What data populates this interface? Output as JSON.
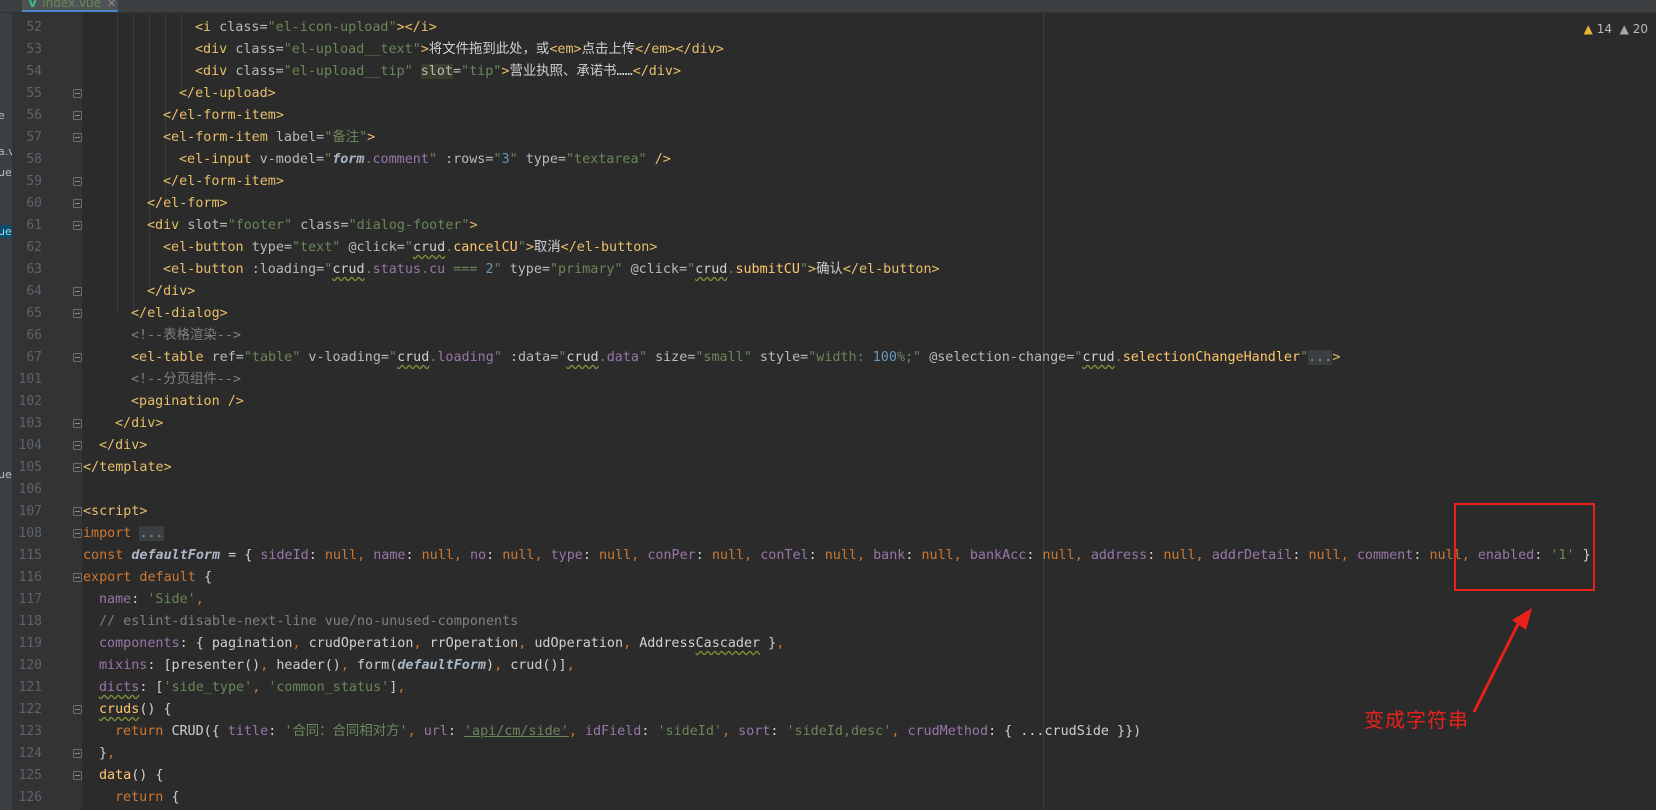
{
  "editor": {
    "tab_label": "index.vue",
    "tab_close": "✕",
    "inspections": {
      "warnings": "14",
      "weak_warnings": "20"
    }
  },
  "left_strip_labels": [
    "e",
    "a.v",
    "ue",
    "ue",
    "ue"
  ],
  "annotation": {
    "text": "变成字符串"
  },
  "colors": {
    "annotation": "#e8211a",
    "background": "#2b2b2b",
    "tag": "#e8bf6a",
    "string": "#6a8759"
  },
  "lines": [
    {
      "no": "52",
      "fold": false,
      "tokens": [
        [
          "t",
          "<i "
        ],
        [
          "a",
          "class="
        ],
        [
          "v",
          "\"el-icon-upload\""
        ],
        [
          "t",
          "></i>"
        ]
      ]
    },
    {
      "no": "53",
      "fold": false,
      "tokens": [
        [
          "t",
          "<div "
        ],
        [
          "a",
          "class="
        ],
        [
          "v",
          "\"el-upload__text\""
        ],
        [
          "t",
          ">"
        ],
        [
          "pl",
          "将文件拖到此处，或"
        ],
        [
          "t",
          "<em>"
        ],
        [
          "pl",
          "点击上传"
        ],
        [
          "t",
          "</em></div>"
        ]
      ]
    },
    {
      "no": "54",
      "fold": false,
      "tokens": [
        [
          "t",
          "<div "
        ],
        [
          "a",
          "class="
        ],
        [
          "v",
          "\"el-upload__tip\" "
        ],
        [
          "a hlw",
          "slot"
        ],
        [
          "a",
          "="
        ],
        [
          "v",
          "\"tip\""
        ],
        [
          "t",
          ">"
        ],
        [
          "pl",
          "营业执照、承诺书……"
        ],
        [
          "t",
          "</div>"
        ]
      ]
    },
    {
      "no": "55",
      "fold": true,
      "tokens": [
        [
          "t",
          "</el-upload>"
        ]
      ]
    },
    {
      "no": "56",
      "fold": true,
      "tokens": [
        [
          "t",
          "</el-form-item>"
        ]
      ]
    },
    {
      "no": "57",
      "fold": true,
      "tokens": [
        [
          "t",
          "<el-form-item "
        ],
        [
          "a",
          "label="
        ],
        [
          "v",
          "\"备注\""
        ],
        [
          "t",
          ">"
        ]
      ]
    },
    {
      "no": "58",
      "fold": false,
      "tokens": [
        [
          "t",
          "<el-input "
        ],
        [
          "a",
          "v-model="
        ],
        [
          "v",
          "\""
        ],
        [
          "ib",
          "form"
        ],
        [
          "v",
          "."
        ],
        [
          "p",
          "comment"
        ],
        [
          "v",
          "\" "
        ],
        [
          "a",
          ":rows="
        ],
        [
          "v",
          "\""
        ],
        [
          "n",
          "3"
        ],
        [
          "v",
          "\" "
        ],
        [
          "a",
          "type="
        ],
        [
          "v",
          "\"textarea\" "
        ],
        [
          "t",
          "/>"
        ]
      ]
    },
    {
      "no": "59",
      "fold": true,
      "tokens": [
        [
          "t",
          "</el-form-item>"
        ]
      ]
    },
    {
      "no": "60",
      "fold": true,
      "tokens": [
        [
          "t",
          "</el-form>"
        ]
      ]
    },
    {
      "no": "61",
      "fold": true,
      "tokens": [
        [
          "t",
          "<div "
        ],
        [
          "a",
          "slot="
        ],
        [
          "v",
          "\"footer\" "
        ],
        [
          "a",
          "class="
        ],
        [
          "v",
          "\"dialog-footer\""
        ],
        [
          "t",
          ">"
        ]
      ]
    },
    {
      "no": "62",
      "fold": false,
      "tokens": [
        [
          "t",
          "<el-button "
        ],
        [
          "a",
          "type="
        ],
        [
          "v",
          "\"text\" "
        ],
        [
          "a",
          "@click="
        ],
        [
          "v",
          "\""
        ],
        [
          "pl u",
          "crud"
        ],
        [
          "v",
          "."
        ],
        [
          "f",
          "cancelCU"
        ],
        [
          "v",
          "\""
        ],
        [
          "t",
          ">"
        ],
        [
          "pl",
          "取消"
        ],
        [
          "t",
          "</el-button>"
        ]
      ]
    },
    {
      "no": "63",
      "fold": false,
      "tokens": [
        [
          "t",
          "<el-button "
        ],
        [
          "a",
          ":loading="
        ],
        [
          "v",
          "\""
        ],
        [
          "pl u",
          "crud"
        ],
        [
          "v",
          "."
        ],
        [
          "p",
          "status"
        ],
        [
          "v",
          "."
        ],
        [
          "p",
          "cu"
        ],
        [
          "v",
          " === "
        ],
        [
          "n",
          "2"
        ],
        [
          "v",
          "\" "
        ],
        [
          "a",
          "type="
        ],
        [
          "v",
          "\"primary\" "
        ],
        [
          "a",
          "@click="
        ],
        [
          "v",
          "\""
        ],
        [
          "pl u",
          "crud"
        ],
        [
          "v",
          "."
        ],
        [
          "f",
          "submitCU"
        ],
        [
          "v",
          "\""
        ],
        [
          "t",
          ">"
        ],
        [
          "pl",
          "确认"
        ],
        [
          "t",
          "</el-button>"
        ]
      ]
    },
    {
      "no": "64",
      "fold": true,
      "tokens": [
        [
          "t",
          "</div>"
        ]
      ]
    },
    {
      "no": "65",
      "fold": true,
      "tokens": [
        [
          "t",
          "</el-dialog>"
        ]
      ]
    },
    {
      "no": "66",
      "fold": false,
      "tokens": [
        [
          "c",
          "<!--表格渲染-->"
        ]
      ]
    },
    {
      "no": "67",
      "fold": true,
      "tokens": [
        [
          "t",
          "<el-table "
        ],
        [
          "a",
          "ref="
        ],
        [
          "v",
          "\"table\" "
        ],
        [
          "a",
          "v-loading="
        ],
        [
          "v",
          "\""
        ],
        [
          "pl u",
          "crud"
        ],
        [
          "v",
          "."
        ],
        [
          "p",
          "loading"
        ],
        [
          "v",
          "\" "
        ],
        [
          "a",
          ":data="
        ],
        [
          "v",
          "\""
        ],
        [
          "pl u",
          "crud"
        ],
        [
          "v",
          "."
        ],
        [
          "p",
          "data"
        ],
        [
          "v",
          "\" "
        ],
        [
          "a",
          "size="
        ],
        [
          "v",
          "\"small\" "
        ],
        [
          "a",
          "style="
        ],
        [
          "v",
          "\"width: "
        ],
        [
          "n",
          "100"
        ],
        [
          "v",
          "%;\" "
        ],
        [
          "a",
          "@selection-change="
        ],
        [
          "v",
          "\""
        ],
        [
          "pl u",
          "crud"
        ],
        [
          "v",
          "."
        ],
        [
          "f",
          "selectionChangeHandler"
        ],
        [
          "v",
          "\""
        ],
        [
          "fd",
          "..."
        ],
        [
          "t",
          ">"
        ]
      ]
    },
    {
      "no": "101",
      "fold": false,
      "tokens": [
        [
          "c",
          "<!--分页组件-->"
        ]
      ]
    },
    {
      "no": "102",
      "fold": false,
      "tokens": [
        [
          "t",
          "<pagination />"
        ]
      ]
    },
    {
      "no": "103",
      "fold": true,
      "tokens": [
        [
          "t",
          "</div>"
        ]
      ]
    },
    {
      "no": "104",
      "fold": true,
      "tokens": [
        [
          "t",
          "</div>"
        ]
      ]
    },
    {
      "no": "105",
      "fold": true,
      "tokens": [
        [
          "t",
          "</template>"
        ]
      ]
    },
    {
      "no": "106",
      "fold": false,
      "tokens": []
    },
    {
      "no": "107",
      "fold": true,
      "tokens": [
        [
          "t",
          "<script>"
        ]
      ]
    },
    {
      "no": "108",
      "fold": true,
      "tokens": [
        [
          "kw",
          "import "
        ],
        [
          "fd",
          "..."
        ]
      ]
    },
    {
      "no": "115",
      "fold": false,
      "tokens": [
        [
          "kw",
          "const "
        ],
        [
          "ib",
          "defaultForm"
        ],
        [
          "pl",
          " = { "
        ],
        [
          "p",
          "sideId"
        ],
        [
          "pl",
          ": "
        ],
        [
          "kw",
          "null"
        ],
        [
          "kw",
          ", "
        ],
        [
          "p",
          "name"
        ],
        [
          "pl",
          ": "
        ],
        [
          "kw",
          "null"
        ],
        [
          "kw",
          ", "
        ],
        [
          "p",
          "no"
        ],
        [
          "pl",
          ": "
        ],
        [
          "kw",
          "null"
        ],
        [
          "kw",
          ", "
        ],
        [
          "p",
          "type"
        ],
        [
          "pl",
          ": "
        ],
        [
          "kw",
          "null"
        ],
        [
          "kw",
          ", "
        ],
        [
          "p",
          "conPer"
        ],
        [
          "pl",
          ": "
        ],
        [
          "kw",
          "null"
        ],
        [
          "kw",
          ", "
        ],
        [
          "p",
          "conTel"
        ],
        [
          "pl",
          ": "
        ],
        [
          "kw",
          "null"
        ],
        [
          "kw",
          ", "
        ],
        [
          "p",
          "bank"
        ],
        [
          "pl",
          ": "
        ],
        [
          "kw",
          "null"
        ],
        [
          "kw",
          ", "
        ],
        [
          "p",
          "bankAcc"
        ],
        [
          "pl",
          ": "
        ],
        [
          "kw",
          "null"
        ],
        [
          "kw",
          ", "
        ],
        [
          "p",
          "address"
        ],
        [
          "pl",
          ": "
        ],
        [
          "kw",
          "null"
        ],
        [
          "kw",
          ", "
        ],
        [
          "p",
          "addrDetail"
        ],
        [
          "pl",
          ": "
        ],
        [
          "kw",
          "null"
        ],
        [
          "kw",
          ", "
        ],
        [
          "p",
          "comment"
        ],
        [
          "pl",
          ": "
        ],
        [
          "kw",
          "null"
        ],
        [
          "kw",
          ", "
        ],
        [
          "p",
          "enabled"
        ],
        [
          "pl",
          ": "
        ],
        [
          "v",
          "'1'"
        ],
        [
          "pl",
          " }"
        ]
      ]
    },
    {
      "no": "116",
      "fold": true,
      "tokens": [
        [
          "kw",
          "export default "
        ],
        [
          "pl",
          "{"
        ]
      ]
    },
    {
      "no": "117",
      "fold": false,
      "tokens": [
        [
          "p",
          "name"
        ],
        [
          "pl",
          ": "
        ],
        [
          "v",
          "'Side'"
        ],
        [
          "kw",
          ","
        ]
      ]
    },
    {
      "no": "118",
      "fold": false,
      "tokens": [
        [
          "c",
          "// eslint-disable-next-line vue/no-unused-components"
        ]
      ]
    },
    {
      "no": "119",
      "fold": false,
      "tokens": [
        [
          "p",
          "components"
        ],
        [
          "pl",
          ": { pagination"
        ],
        [
          "kw",
          ", "
        ],
        [
          "pl",
          "crudOperation"
        ],
        [
          "kw",
          ", "
        ],
        [
          "pl",
          "rrOperation"
        ],
        [
          "kw",
          ", "
        ],
        [
          "pl",
          "udOperation"
        ],
        [
          "kw",
          ", "
        ],
        [
          "pl",
          "Address"
        ],
        [
          "pl u",
          "Cascader"
        ],
        [
          "pl",
          " }"
        ],
        [
          "kw",
          ","
        ]
      ]
    },
    {
      "no": "120",
      "fold": false,
      "tokens": [
        [
          "p",
          "mixins"
        ],
        [
          "pl",
          ": [presenter()"
        ],
        [
          "kw",
          ", "
        ],
        [
          "pl",
          "header()"
        ],
        [
          "kw",
          ", "
        ],
        [
          "pl",
          "form("
        ],
        [
          "ib",
          "defaultForm"
        ],
        [
          "pl",
          ")"
        ],
        [
          "kw",
          ", "
        ],
        [
          "pl",
          "crud()]"
        ],
        [
          "kw",
          ","
        ]
      ]
    },
    {
      "no": "121",
      "fold": false,
      "tokens": [
        [
          "p u",
          "dicts"
        ],
        [
          "pl",
          ": ["
        ],
        [
          "v",
          "'side_type'"
        ],
        [
          "kw",
          ", "
        ],
        [
          "v",
          "'common_status'"
        ],
        [
          "pl",
          "]"
        ],
        [
          "kw",
          ","
        ]
      ]
    },
    {
      "no": "122",
      "fold": true,
      "tokens": [
        [
          "f u",
          "cruds"
        ],
        [
          "pl",
          "() {"
        ]
      ]
    },
    {
      "no": "123",
      "fold": false,
      "tokens": [
        [
          "kw",
          "return "
        ],
        [
          "pl",
          "CRUD({ "
        ],
        [
          "p",
          "title"
        ],
        [
          "pl",
          ": "
        ],
        [
          "v",
          "'合同：合同相对方'"
        ],
        [
          "kw",
          ", "
        ],
        [
          "p",
          "url"
        ],
        [
          "pl",
          ": "
        ],
        [
          "v ul",
          "'api/cm/side'"
        ],
        [
          "kw",
          ", "
        ],
        [
          "p",
          "idField"
        ],
        [
          "pl",
          ": "
        ],
        [
          "v",
          "'sideId'"
        ],
        [
          "kw",
          ", "
        ],
        [
          "p",
          "sort"
        ],
        [
          "pl",
          ": "
        ],
        [
          "v",
          "'sideId,desc'"
        ],
        [
          "kw",
          ", "
        ],
        [
          "p",
          "crudMethod"
        ],
        [
          "pl",
          ": { ...crudSide }})"
        ]
      ]
    },
    {
      "no": "124",
      "fold": true,
      "tokens": [
        [
          "pl",
          "}"
        ],
        [
          "kw",
          ","
        ]
      ]
    },
    {
      "no": "125",
      "fold": true,
      "tokens": [
        [
          "f",
          "data"
        ],
        [
          "pl",
          "() {"
        ]
      ]
    },
    {
      "no": "126",
      "fold": false,
      "tokens": [
        [
          "kw",
          "return "
        ],
        [
          "pl",
          "{"
        ]
      ]
    }
  ]
}
